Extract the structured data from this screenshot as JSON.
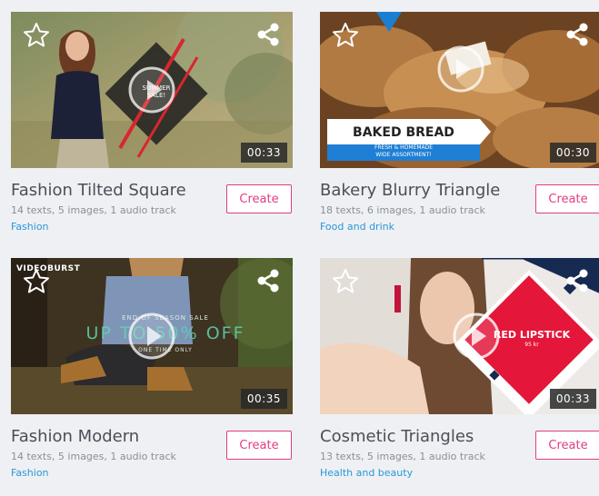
{
  "colors": {
    "accent": "#e03c83",
    "category_link": "#2a97d8",
    "title_text": "#4a4f58",
    "meta_text": "#8a8f98"
  },
  "icons": [
    "star-icon",
    "share-icon",
    "play-icon"
  ],
  "templates": [
    {
      "title": "Fashion Tilted Square",
      "meta": "14 texts, 5 images, 1 audio track",
      "category": "Fashion",
      "duration": "00:33",
      "create_label": "Create",
      "overlay_lines": [
        "SUMMER",
        "SALE!"
      ]
    },
    {
      "title": "Bakery Blurry Triangle",
      "meta": "18 texts, 6 images, 1 audio track",
      "category": "Food and drink",
      "duration": "00:30",
      "create_label": "Create",
      "overlay_lines": [
        "BAKED BREAD",
        "FRESH & HOMEMADE",
        "WIDE ASSORTMENT!"
      ]
    },
    {
      "title": "Fashion Modern",
      "meta": "14 texts, 5 images, 1 audio track",
      "category": "Fashion",
      "duration": "00:35",
      "create_label": "Create",
      "overlay_lines": [
        "VIDEOBURST",
        "END OF SEASON SALE",
        "UP TO 50% OFF",
        "ONE TIME ONLY"
      ]
    },
    {
      "title": "Cosmetic Triangles",
      "meta": "13 texts, 5 images, 1 audio track",
      "category": "Health and beauty",
      "duration": "00:33",
      "create_label": "Create",
      "overlay_lines": [
        "RED LIPSTICK",
        "95 kr"
      ]
    }
  ]
}
